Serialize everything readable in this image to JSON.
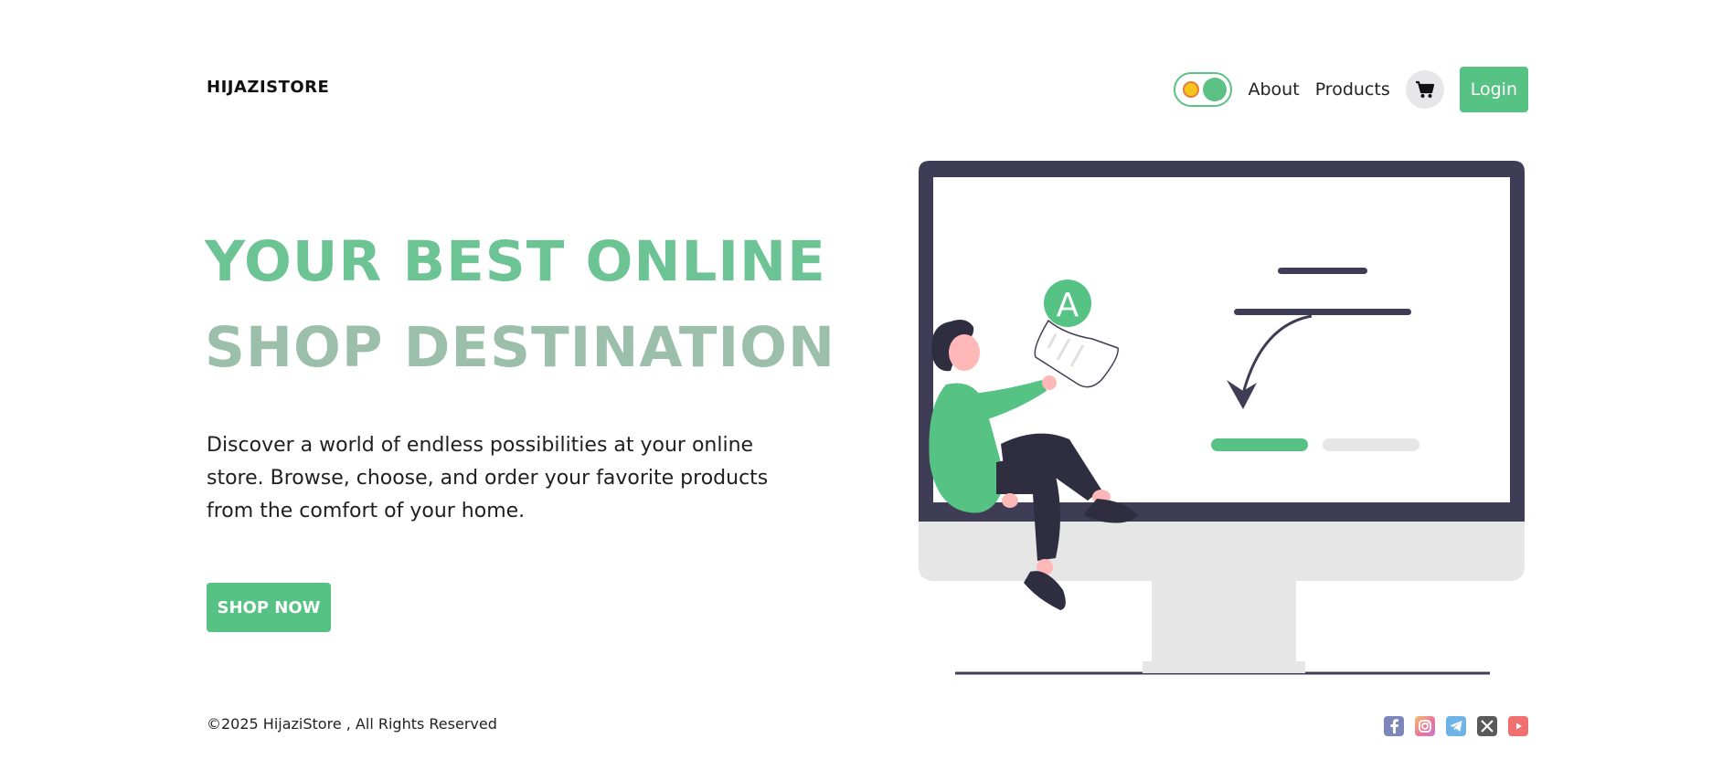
{
  "header": {
    "brand": "HIJAZISTORE",
    "nav": {
      "about": "About",
      "products": "Products",
      "login": "Login"
    }
  },
  "hero": {
    "headline_line1": "YOUR BEST ONLINE",
    "headline_line2": "SHOP DESTINATION",
    "description": "Discover a world of endless possibilities at your online store. Browse, choose, and order your favorite products from the comfort of your home.",
    "cta": "SHOP NOW"
  },
  "illustration": {
    "badge_letter": "A"
  },
  "footer": {
    "copyright": "©2025 HijaziStore , All Rights Reserved",
    "socials": [
      "facebook-icon",
      "instagram-icon",
      "telegram-icon",
      "x-icon",
      "youtube-icon"
    ]
  },
  "colors": {
    "accent": "#56c283",
    "headline_primary": "#6cc393",
    "headline_secondary": "#9cbfac",
    "monitor_frame": "#3f3d56"
  }
}
